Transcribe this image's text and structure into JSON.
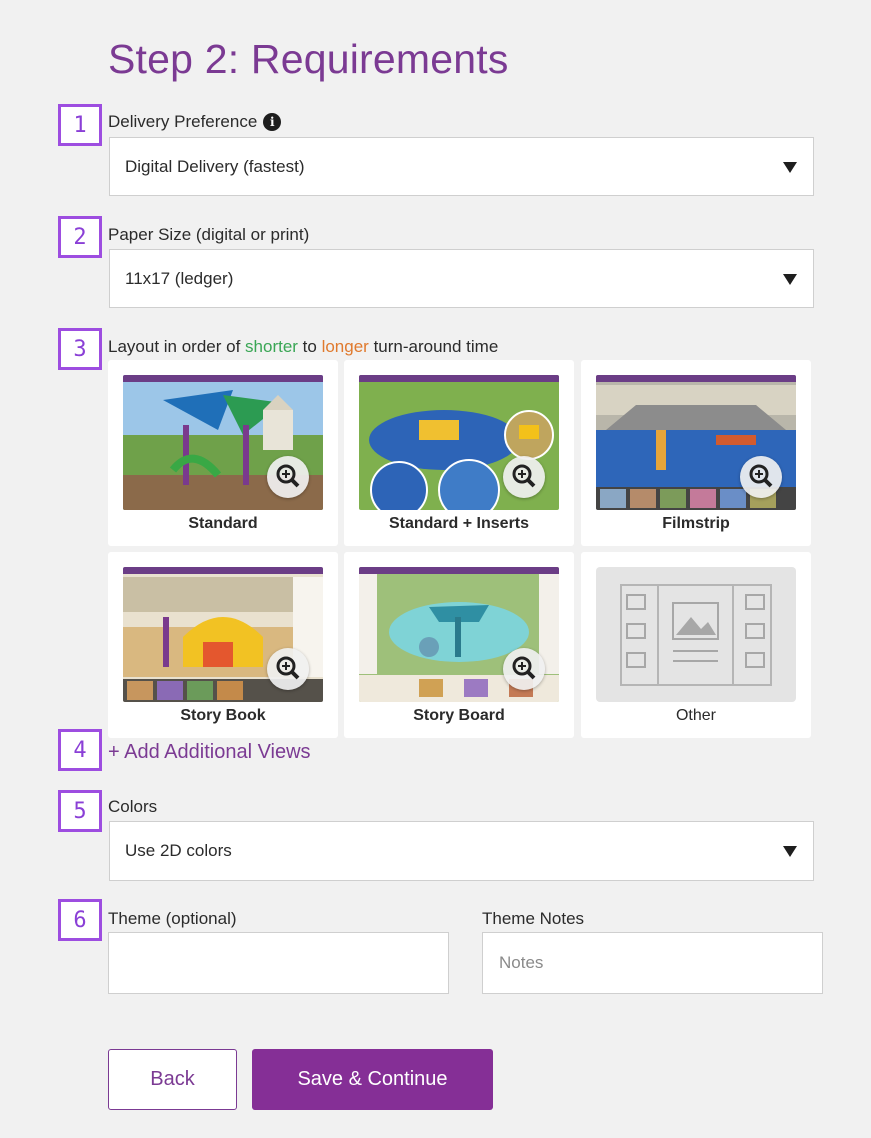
{
  "page": {
    "title": "Step 2: Requirements"
  },
  "steps": [
    "1",
    "2",
    "3",
    "4",
    "5",
    "6"
  ],
  "delivery": {
    "label": "Delivery Preference",
    "info_icon": "i",
    "value": "Digital Delivery (fastest)"
  },
  "paper": {
    "label": "Paper Size (digital or print)",
    "value": "11x17 (ledger)"
  },
  "layout": {
    "label_prefix": "Layout in order of ",
    "label_shorter": "shorter",
    "label_mid": " to ",
    "label_longer": "longer",
    "label_suffix": " turn-around time",
    "options": [
      {
        "caption": "Standard"
      },
      {
        "caption": "Standard + Inserts"
      },
      {
        "caption": "Filmstrip"
      },
      {
        "caption": "Story Book"
      },
      {
        "caption": "Story Board"
      },
      {
        "caption": "Other"
      }
    ]
  },
  "add_views": {
    "label": "+ Add Additional Views"
  },
  "colors": {
    "label": "Colors",
    "value": "Use 2D colors"
  },
  "theme": {
    "label": "Theme (optional)",
    "value": ""
  },
  "theme_notes": {
    "label": "Theme Notes",
    "placeholder": "Notes"
  },
  "buttons": {
    "back": "Back",
    "save": "Save & Continue"
  },
  "palette": {
    "brand_purple": "#7b3a93",
    "button_purple": "#852f96",
    "badge_purple": "#9d4de0",
    "green": "#3aa655",
    "orange": "#e07a2e"
  }
}
